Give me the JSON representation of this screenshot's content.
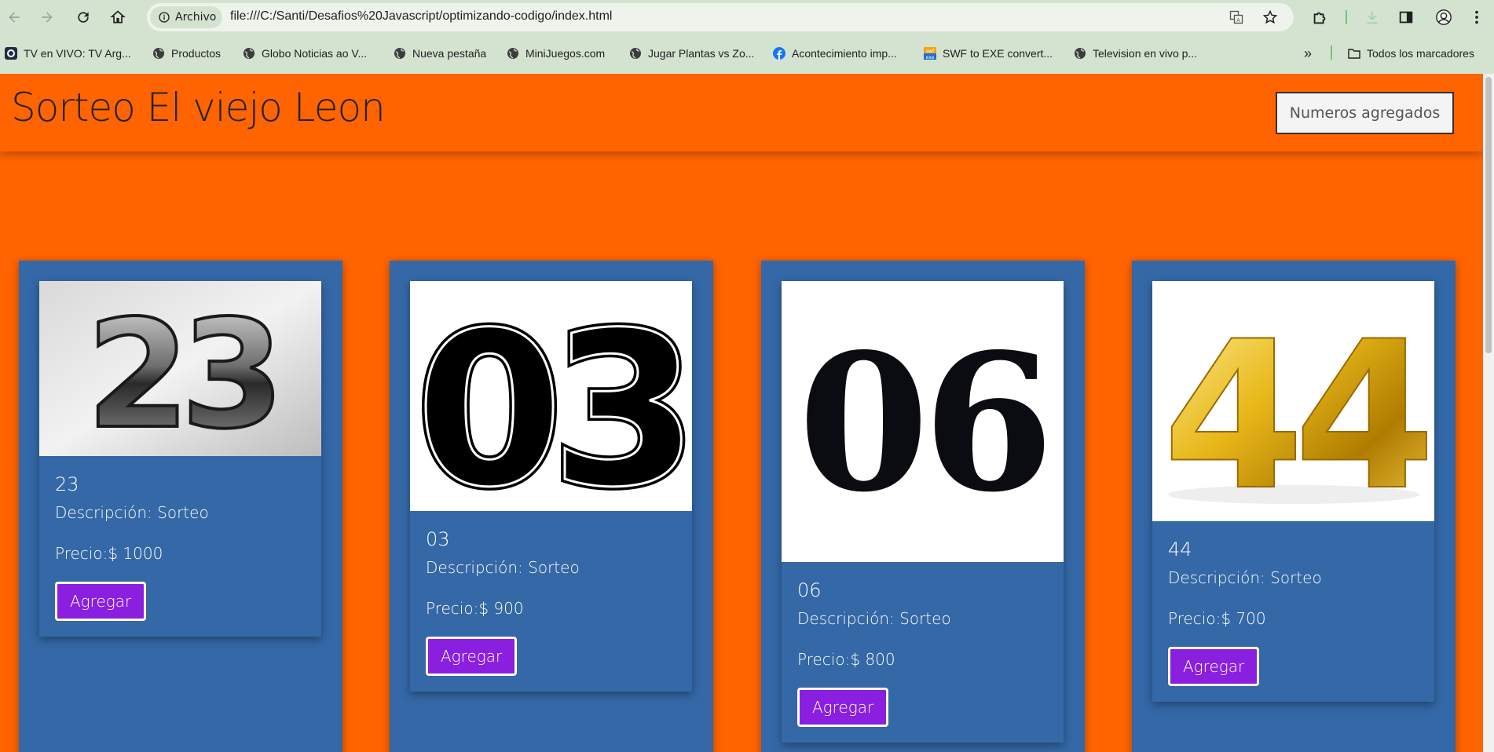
{
  "browser": {
    "security_chip": "Archivo",
    "url": "file:///C:/Santi/Desafios%20Javascript/optimizando-codigo/index.html",
    "bookmarks": [
      {
        "label": "TV en VIVO: TV Arg...",
        "icon": "tv-app-icon"
      },
      {
        "label": "Productos",
        "icon": "globe-icon"
      },
      {
        "label": "Globo Noticias ao V...",
        "icon": "globe-icon"
      },
      {
        "label": "Nueva pestaña",
        "icon": "globe-icon"
      },
      {
        "label": "MiniJuegos.com",
        "icon": "globe-icon"
      },
      {
        "label": "Jugar Plantas vs Zo...",
        "icon": "globe-icon"
      },
      {
        "label": "Acontecimiento imp...",
        "icon": "facebook-icon"
      },
      {
        "label": "SWF to EXE convert...",
        "icon": "swf-exe-icon"
      },
      {
        "label": "Television en vivo p...",
        "icon": "globe-icon"
      }
    ],
    "overflow_label": "»",
    "all_bookmarks_label": "Todos los marcadores"
  },
  "site": {
    "title": "Sorteo El viejo Leon",
    "header_button": "Numeros agregados"
  },
  "products": [
    {
      "number": "23",
      "description": "Descripción: Sorteo",
      "price": "Precio:$ 1000",
      "button": "Agregar",
      "image_text": "23"
    },
    {
      "number": "03",
      "description": "Descripción: Sorteo",
      "price": "Precio:$ 900",
      "button": "Agregar",
      "image_text": "03"
    },
    {
      "number": "06",
      "description": "Descripción: Sorteo",
      "price": "Precio:$ 800",
      "button": "Agregar",
      "image_text": "06"
    },
    {
      "number": "44",
      "description": "Descripción: Sorteo",
      "price": "Precio:$ 700",
      "button": "Agregar",
      "image_text": "44"
    }
  ],
  "colors": {
    "page_background": "#ff6400",
    "card_background": "#3468a6",
    "button_background": "#8a1fe0",
    "chrome_background": "#d3e3d0"
  }
}
